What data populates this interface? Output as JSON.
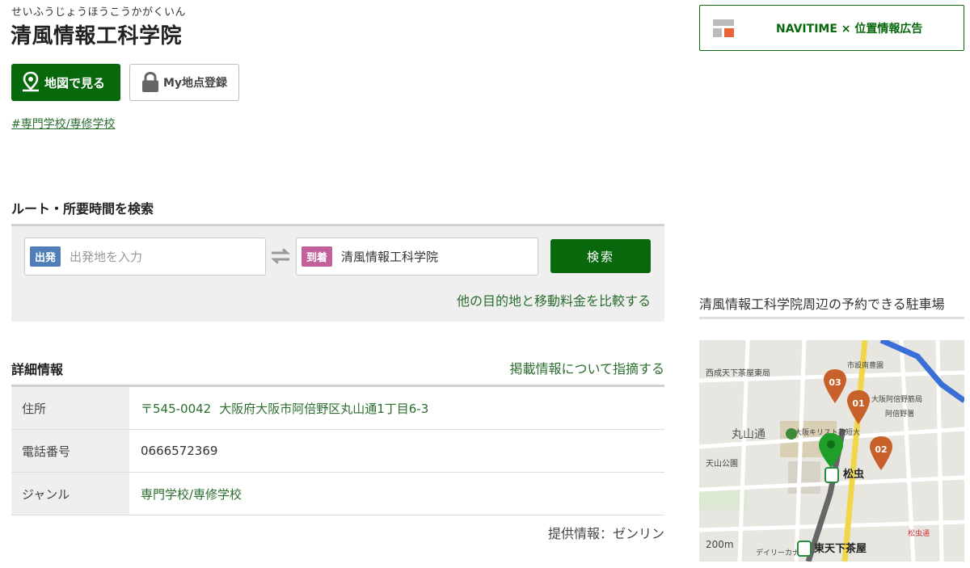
{
  "place": {
    "furigana": "せいふうじょうほうこうかがくいん",
    "name": "清風情報工科学院"
  },
  "actions": {
    "map_label": "地図で見る",
    "myspot_label": "My地点登録"
  },
  "tags": [
    "#専門学校/専修学校"
  ],
  "route": {
    "heading": "ルート・所要時間を検索",
    "from_badge": "出発",
    "from_placeholder": "出発地を入力",
    "to_badge": "到着",
    "to_value": "清風情報工科学院",
    "search_label": "検索",
    "compare_link": "他の目的地と移動料金を比較する"
  },
  "details": {
    "heading": "詳細情報",
    "report_link": "掲載情報について指摘する",
    "rows": [
      {
        "label": "住所",
        "zip": "〒545-0042",
        "value": "大阪府大阪市阿倍野区丸山通1丁目6-3"
      },
      {
        "label": "電話番号",
        "value": "0666572369"
      },
      {
        "label": "ジャンル",
        "value": "専門学校/専修学校"
      }
    ],
    "provider": "提供情報：ゼンリン"
  },
  "ad": {
    "label": "NAVITIME × 位置情報広告"
  },
  "parking": {
    "title": "清風情報工科学院周辺の予約できる駐車場",
    "map": {
      "labels": {
        "top_left": "西成天下茶屋東局",
        "city": "市設南豊園",
        "street": "丸山通",
        "park": "天山公園",
        "post": "大阪阿倍野筋局",
        "police": "阿倍野署",
        "school": "大阪キリスト教短大",
        "station1": "松虫",
        "station2": "東天下茶屋",
        "scale": "200m",
        "road": "松虫通",
        "daily": "デイリーカナート"
      },
      "markers": [
        "01",
        "02",
        "03"
      ]
    }
  },
  "colors": {
    "primary_green": "#08680c",
    "link_green": "#2a6e2e",
    "from_badge": "#4f7eb8",
    "to_badge": "#c35f9b",
    "marker_orange": "#c8602a"
  }
}
